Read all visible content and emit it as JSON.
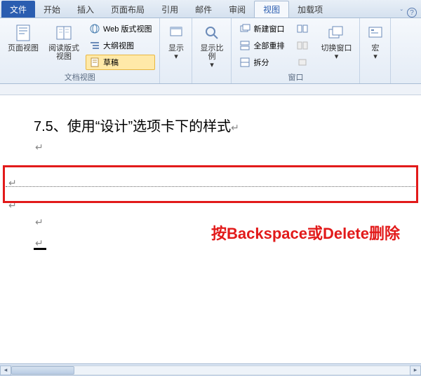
{
  "tabs": {
    "file": "文件",
    "home": "开始",
    "insert": "插入",
    "layout": "页面布局",
    "references": "引用",
    "mail": "邮件",
    "review": "审阅",
    "view": "视图",
    "addins": "加载项"
  },
  "ribbon": {
    "group_views": "文档视图",
    "group_window": "窗口",
    "page_view": "页面视图",
    "reading_view": "阅读版式\n视图",
    "web_view": "Web 版式视图",
    "outline": "大纲视图",
    "draft": "草稿",
    "show": "显示",
    "zoom": "显示比例",
    "new_window": "新建窗口",
    "arrange_all": "全部重排",
    "split": "拆分",
    "switch_window": "切换窗口",
    "macros": "宏"
  },
  "document": {
    "heading": "7.5、使用“设计”选项卡下的样式",
    "para_mark": "↵",
    "annotation": "按Backspace或Delete删除"
  },
  "help": "?"
}
